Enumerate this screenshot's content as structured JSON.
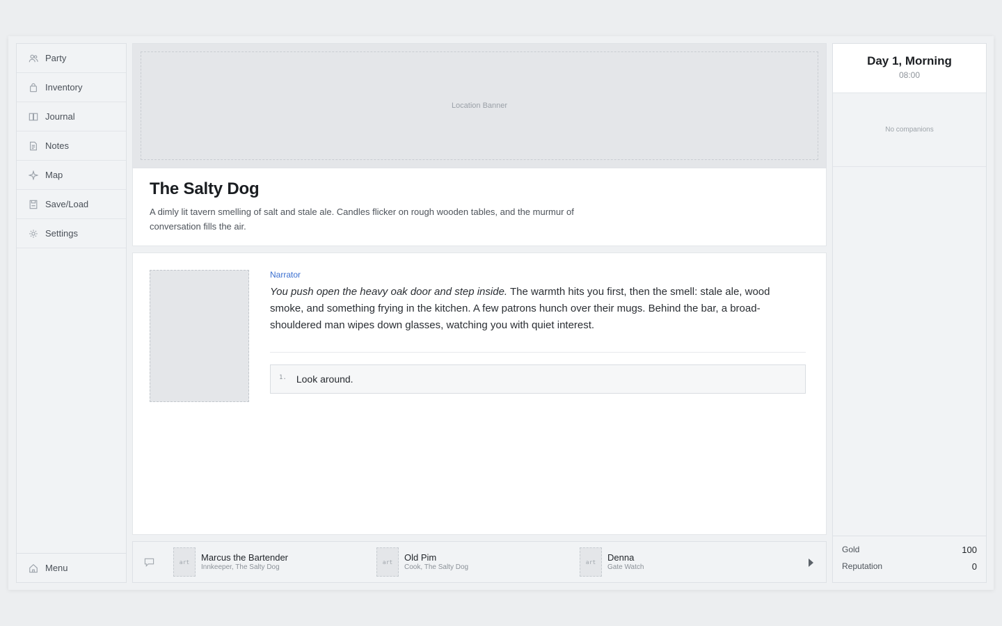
{
  "sidebar": {
    "items": [
      {
        "label": "Party",
        "icon": "party-icon"
      },
      {
        "label": "Inventory",
        "icon": "bag-icon"
      },
      {
        "label": "Journal",
        "icon": "book-icon"
      },
      {
        "label": "Notes",
        "icon": "note-icon"
      },
      {
        "label": "Map",
        "icon": "compass-icon"
      },
      {
        "label": "Save/Load",
        "icon": "save-icon"
      },
      {
        "label": "Settings",
        "icon": "gear-icon"
      }
    ],
    "menu_label": "Menu"
  },
  "banner": {
    "label": "Location Banner"
  },
  "location": {
    "title": "The Salty Dog",
    "description": "A dimly lit tavern smelling of salt and stale ale. Candles flicker on rough wooden tables, and the murmur of conversation fills the air."
  },
  "story": {
    "speaker": "Narrator",
    "intro_italic": "You push open the heavy oak door and step inside.",
    "text": " The warmth hits you first, then the smell: stale ale, wood smoke, and something frying in the kitchen. A few patrons hunch over their mugs. Behind the bar, a broad-shouldered man wipes down glasses, watching you with quiet interest.",
    "choices": [
      {
        "num": "1.",
        "text": "Look around."
      }
    ]
  },
  "npcs": [
    {
      "art": "art",
      "name": "Marcus the Bartender",
      "role": "Innkeeper, The Salty Dog"
    },
    {
      "art": "art",
      "name": "Old Pim",
      "role": "Cook, The Salty Dog"
    },
    {
      "art": "art",
      "name": "Denna",
      "role": "Gate Watch"
    }
  ],
  "clock": {
    "day": "Day 1, Morning",
    "time": "08:00"
  },
  "companions": {
    "empty_text": "No companions"
  },
  "stats": [
    {
      "label": "Gold",
      "value": "100"
    },
    {
      "label": "Reputation",
      "value": "0"
    }
  ],
  "colors": {
    "accent": "#3a6fd0",
    "background": "#eceef0",
    "panel": "#f1f3f5"
  }
}
